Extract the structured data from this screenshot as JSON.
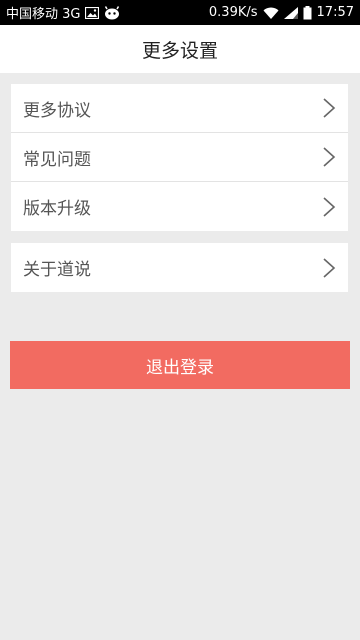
{
  "status_bar": {
    "carrier": "中国移动 3G",
    "speed": "0.39K/s",
    "time": "17:57"
  },
  "header": {
    "title": "更多设置"
  },
  "settings": {
    "group1": [
      {
        "label": "更多协议"
      },
      {
        "label": "常见问题"
      },
      {
        "label": "版本升级"
      }
    ],
    "group2": [
      {
        "label": "关于道说"
      }
    ]
  },
  "logout_label": "退出登录",
  "colors": {
    "logout_button": "#f26b61",
    "background": "#ebebeb"
  }
}
